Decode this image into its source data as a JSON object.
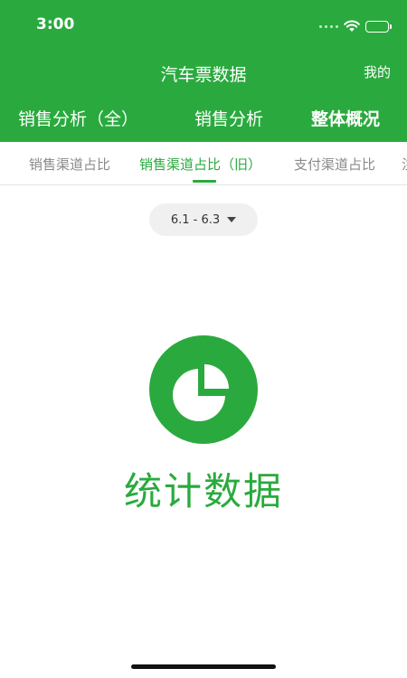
{
  "status_bar": {
    "time": "3:00"
  },
  "nav": {
    "title": "汽车票数据",
    "right_link": "我的"
  },
  "main_tabs": [
    {
      "label": "销售分析（全）"
    },
    {
      "label": "销售分析"
    },
    {
      "label": "整体概况"
    }
  ],
  "sub_tabs": [
    {
      "label": "销售渠道占比"
    },
    {
      "label": "销售渠道占比（旧）"
    },
    {
      "label": "支付渠道占比"
    },
    {
      "label": "注"
    }
  ],
  "date_filter": {
    "label": "6.1 - 6.3"
  },
  "content": {
    "label": "统计数据"
  },
  "colors": {
    "brand_green": "#2aaa3e",
    "inactive_tab": "#8a8a8a",
    "pill_bg": "#f0f0f0"
  }
}
